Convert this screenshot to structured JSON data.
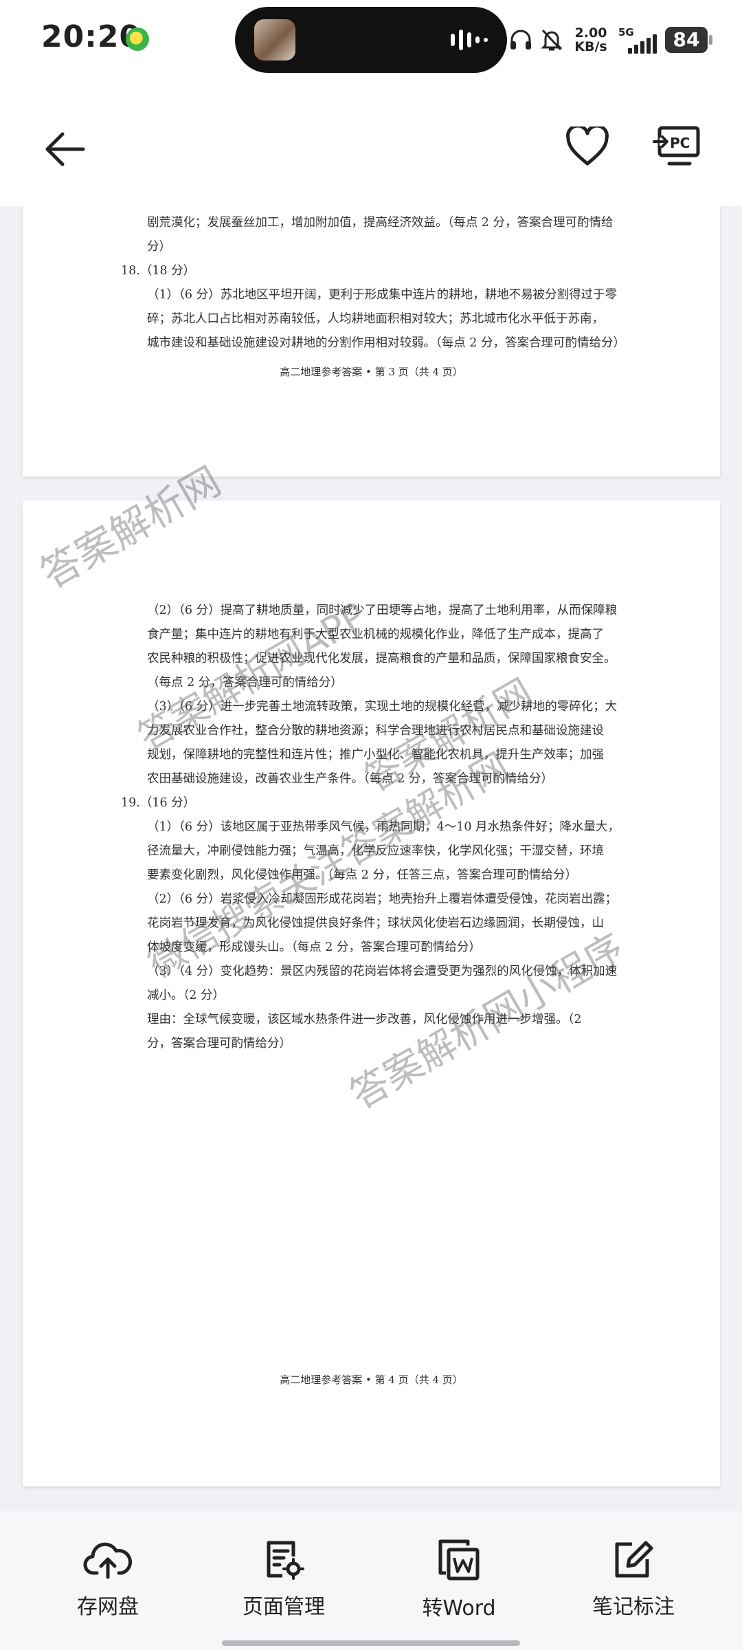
{
  "status_bar": {
    "time": "20:20",
    "net_speed_value": "2.00",
    "net_speed_unit": "KB/s",
    "network": "5G",
    "battery": "84"
  },
  "header": {
    "back_icon": "arrow-left-icon",
    "favorite_icon": "heart-icon",
    "pc_icon": "pc-projection-icon",
    "pc_label": "PC"
  },
  "document": {
    "page3": {
      "lines": [
        "剧荒漠化；发展蚕丝加工，增加附加值，提高经济效益。（每点 2 分，答案合理可酌情给",
        "分）",
        "18.（18 分）",
        "（1）（6 分）苏北地区平坦开阔，更利于形成集中连片的耕地，耕地不易被分割得过于零",
        "碎；苏北人口占比相对苏南较低，人均耕地面积相对较大；苏北城市化水平低于苏南，",
        "城市建设和基础设施建设对耕地的分割作用相对较弱。（每点 2 分，答案合理可酌情给分）"
      ],
      "footer": "高二地理参考答案 • 第 3 页（共 4 页）"
    },
    "page4": {
      "lines": [
        "（2）（6 分）提高了耕地质量，同时减少了田埂等占地，提高了土地利用率，从而保障粮",
        "食产量；集中连片的耕地有利于大型农业机械的规模化作业，降低了生产成本，提高了",
        "农民种粮的积极性；促进农业现代化发展，提高粮食的产量和品质，保障国家粮食安全。",
        "（每点 2 分，答案合理可酌情给分）",
        "（3）（6 分）进一步完善土地流转政策，实现土地的规模化经营，减少耕地的零碎化；大",
        "力发展农业合作社，整合分散的耕地资源；科学合理地进行农村居民点和基础设施建设",
        "规划，保障耕地的完整性和连片性；推广小型化、智能化农机具，提升生产效率；加强",
        "农田基础设施建设，改善农业生产条件。（每点 2 分，答案合理可酌情给分）",
        "19.（16 分）",
        "（1）（6 分）该地区属于亚热带季风气候，雨热同期，4～10 月水热条件好；降水量大，",
        "径流量大，冲刷侵蚀能力强；气温高，化学反应速率快，化学风化强；干湿交替，环境",
        "要素变化剧烈，风化侵蚀作用强。（每点 2 分，任答三点，答案合理可酌情给分）",
        "（2）（6 分）岩浆侵入冷却凝固形成花岗岩；地壳抬升上覆岩体遭受侵蚀，花岗岩出露；",
        "花岗岩节理发育，为风化侵蚀提供良好条件；球状风化使岩石边缘圆润，长期侵蚀，山",
        "体坡度变缓，形成馒头山。（每点 2 分，答案合理可酌情给分）",
        "（3）（4 分）变化趋势：景区内残留的花岗岩体将会遭受更为强烈的风化侵蚀，体积加速",
        "减小。（2 分）",
        "理由：全球气候变暖，该区域水热条件进一步改善，风化侵蚀作用进一步增强。（2",
        "分，答案合理可酌情给分）"
      ],
      "footer": "高二地理参考答案 • 第 4 页（共 4 页）"
    },
    "watermarks": [
      "答案解析网",
      "答案解析网APP",
      "答案解析网",
      "微信搜索关注答案解析网",
      "答案解析网小程序"
    ]
  },
  "toolbar": {
    "items": [
      {
        "label": "存网盘",
        "icon": "cloud-upload-icon"
      },
      {
        "label": "页面管理",
        "icon": "page-manage-icon"
      },
      {
        "label": "转Word",
        "icon": "word-convert-icon"
      },
      {
        "label": "笔记标注",
        "icon": "edit-note-icon"
      }
    ]
  }
}
